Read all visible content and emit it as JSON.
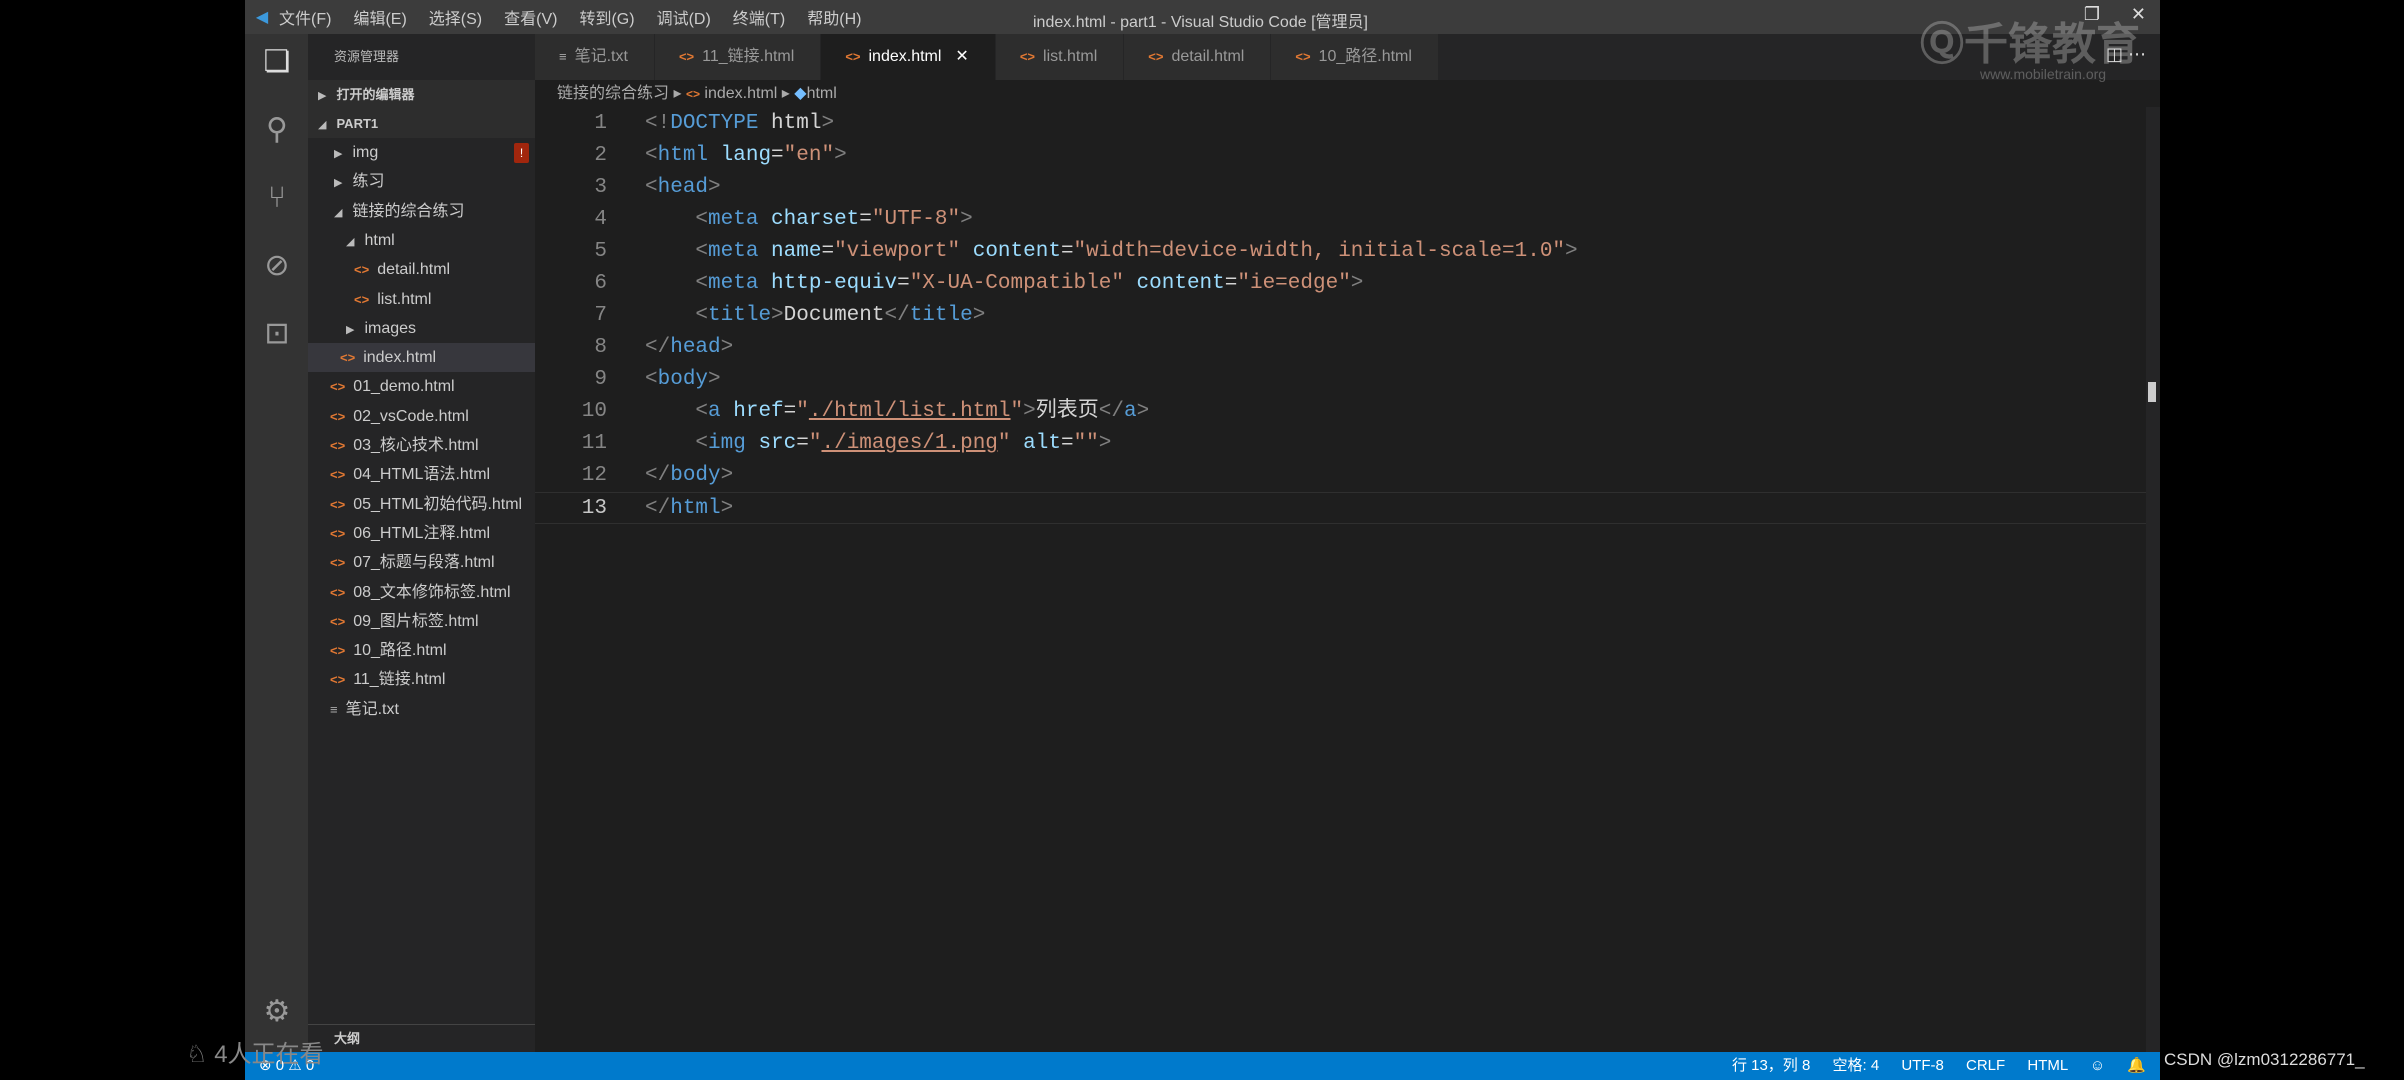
{
  "titlebar": {
    "menu": [
      "文件(F)",
      "编辑(E)",
      "选择(S)",
      "查看(V)",
      "转到(G)",
      "调试(D)",
      "终端(T)",
      "帮助(H)"
    ],
    "title": "index.html - part1 - Visual Studio Code [管理员]"
  },
  "watermark": {
    "brand": "千锋教育",
    "url": "www.mobiletrain.org"
  },
  "sidebar": {
    "header": "资源管理器",
    "open_editors": "打开的编辑器",
    "folder": "PART1",
    "outline": "大纲",
    "items": [
      {
        "label": "img",
        "kind": "folder",
        "collapsed": true,
        "badge": "!"
      },
      {
        "label": "练习",
        "kind": "folder",
        "collapsed": true
      },
      {
        "label": "链接的综合练习",
        "kind": "folder",
        "collapsed": false
      },
      {
        "label": "html",
        "kind": "folder",
        "collapsed": false
      },
      {
        "label": "detail.html",
        "kind": "html"
      },
      {
        "label": "list.html",
        "kind": "html"
      },
      {
        "label": "images",
        "kind": "folder",
        "collapsed": true
      },
      {
        "label": "index.html",
        "kind": "html",
        "selected": true
      },
      {
        "label": "01_demo.html",
        "kind": "html"
      },
      {
        "label": "02_vsCode.html",
        "kind": "html"
      },
      {
        "label": "03_核心技术.html",
        "kind": "html"
      },
      {
        "label": "04_HTML语法.html",
        "kind": "html"
      },
      {
        "label": "05_HTML初始代码.html",
        "kind": "html"
      },
      {
        "label": "06_HTML注释.html",
        "kind": "html"
      },
      {
        "label": "07_标题与段落.html",
        "kind": "html"
      },
      {
        "label": "08_文本修饰标签.html",
        "kind": "html"
      },
      {
        "label": "09_图片标签.html",
        "kind": "html"
      },
      {
        "label": "10_路径.html",
        "kind": "html"
      },
      {
        "label": "11_链接.html",
        "kind": "html"
      },
      {
        "label": "笔记.txt",
        "kind": "txt"
      }
    ]
  },
  "tabs": [
    {
      "label": "笔记.txt",
      "kind": "txt"
    },
    {
      "label": "11_链接.html",
      "kind": "html"
    },
    {
      "label": "index.html",
      "kind": "html",
      "active": true
    },
    {
      "label": "list.html",
      "kind": "html"
    },
    {
      "label": "detail.html",
      "kind": "html"
    },
    {
      "label": "10_路径.html",
      "kind": "html"
    }
  ],
  "breadcrumb": {
    "folder": "链接的综合练习",
    "file": "index.html",
    "symbol": "html"
  },
  "code": {
    "current_line": 13,
    "lines": [
      [
        [
          "br",
          "<!"
        ],
        [
          "kw",
          "DOCTYPE"
        ],
        [
          "txt",
          " html"
        ],
        [
          "br",
          ">"
        ]
      ],
      [
        [
          "br",
          "<"
        ],
        [
          "tag",
          "html"
        ],
        [
          "attr",
          " lang"
        ],
        [
          "txt",
          "="
        ],
        [
          "str",
          "\"en\""
        ],
        [
          "br",
          ">"
        ]
      ],
      [
        [
          "br",
          "<"
        ],
        [
          "tag",
          "head"
        ],
        [
          "br",
          ">"
        ]
      ],
      [
        [
          "txt",
          "    "
        ],
        [
          "br",
          "<"
        ],
        [
          "tag",
          "meta"
        ],
        [
          "attr",
          " charset"
        ],
        [
          "txt",
          "="
        ],
        [
          "str",
          "\"UTF-8\""
        ],
        [
          "br",
          ">"
        ]
      ],
      [
        [
          "txt",
          "    "
        ],
        [
          "br",
          "<"
        ],
        [
          "tag",
          "meta"
        ],
        [
          "attr",
          " name"
        ],
        [
          "txt",
          "="
        ],
        [
          "str",
          "\"viewport\""
        ],
        [
          "attr",
          " content"
        ],
        [
          "txt",
          "="
        ],
        [
          "str",
          "\"width=device-width, initial-scale=1.0\""
        ],
        [
          "br",
          ">"
        ]
      ],
      [
        [
          "txt",
          "    "
        ],
        [
          "br",
          "<"
        ],
        [
          "tag",
          "meta"
        ],
        [
          "attr",
          " http-equiv"
        ],
        [
          "txt",
          "="
        ],
        [
          "str",
          "\"X-UA-Compatible\""
        ],
        [
          "attr",
          " content"
        ],
        [
          "txt",
          "="
        ],
        [
          "str",
          "\"ie=edge\""
        ],
        [
          "br",
          ">"
        ]
      ],
      [
        [
          "txt",
          "    "
        ],
        [
          "br",
          "<"
        ],
        [
          "tag",
          "title"
        ],
        [
          "br",
          ">"
        ],
        [
          "txt",
          "Document"
        ],
        [
          "br",
          "</"
        ],
        [
          "tag",
          "title"
        ],
        [
          "br",
          ">"
        ]
      ],
      [
        [
          "br",
          "</"
        ],
        [
          "tag",
          "head"
        ],
        [
          "br",
          ">"
        ]
      ],
      [
        [
          "br",
          "<"
        ],
        [
          "tag",
          "body"
        ],
        [
          "br",
          ">"
        ]
      ],
      [
        [
          "txt",
          "    "
        ],
        [
          "br",
          "<"
        ],
        [
          "tag",
          "a"
        ],
        [
          "attr",
          " href"
        ],
        [
          "txt",
          "="
        ],
        [
          "str",
          "\""
        ],
        [
          "link",
          "./html/list.html"
        ],
        [
          "str",
          "\""
        ],
        [
          "br",
          ">"
        ],
        [
          "txt",
          "列表页"
        ],
        [
          "br",
          "</"
        ],
        [
          "tag",
          "a"
        ],
        [
          "br",
          ">"
        ]
      ],
      [
        [
          "txt",
          "    "
        ],
        [
          "br",
          "<"
        ],
        [
          "tag",
          "img"
        ],
        [
          "attr",
          " src"
        ],
        [
          "txt",
          "="
        ],
        [
          "str",
          "\""
        ],
        [
          "link",
          "./images/1.png"
        ],
        [
          "str",
          "\""
        ],
        [
          "attr",
          " alt"
        ],
        [
          "txt",
          "="
        ],
        [
          "str",
          "\"\""
        ],
        [
          "br",
          ">"
        ]
      ],
      [
        [
          "br",
          "</"
        ],
        [
          "tag",
          "body"
        ],
        [
          "br",
          ">"
        ]
      ],
      [
        [
          "br",
          "</"
        ],
        [
          "tag",
          "html"
        ],
        [
          "br",
          ">"
        ]
      ]
    ]
  },
  "status": {
    "errors": "0",
    "warnings": "0",
    "position": "行 13，列 8",
    "spaces": "空格: 4",
    "encoding": "UTF-8",
    "eol": "CRLF",
    "language": "HTML"
  },
  "overlay": {
    "csdn": "CSDN @lzm0312286771_",
    "viewers": "4人正在看"
  },
  "colors": {
    "statusbar": "#007acc",
    "html_icon": "#e37933",
    "badge": "#a1260d"
  }
}
